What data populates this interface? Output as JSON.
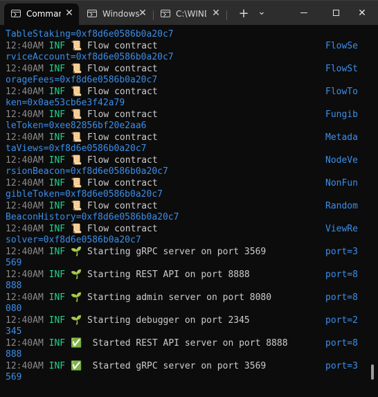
{
  "window": {
    "tabs": [
      {
        "label": "Comman",
        "active": true
      },
      {
        "label": "Windows",
        "active": false
      },
      {
        "label": "C:\\WINDO",
        "active": false
      }
    ],
    "new_tab_glyph": "+",
    "dropdown_glyph": "⌄",
    "minimize_glyph": "",
    "maximize_glyph": "",
    "close_glyph": "✕",
    "tab_close_glyph": "✕"
  },
  "colors": {
    "background": "#0c0c0c",
    "timestamp": "#8a8a8a",
    "level": "#23d18b",
    "message": "#cccccc",
    "key": "#3b8eea"
  },
  "log": {
    "top_continuation": "TableStaking=0xf8d6e0586b0a20c7",
    "entries": [
      {
        "time": "12:40AM",
        "level": "INF",
        "icon": "📜",
        "message": "Flow contract",
        "key": "FlowSe",
        "continuation": "rviceAccount=0xf8d6e0586b0a20c7"
      },
      {
        "time": "12:40AM",
        "level": "INF",
        "icon": "📜",
        "message": "Flow contract",
        "key": "FlowSt",
        "continuation": "orageFees=0xf8d6e0586b0a20c7"
      },
      {
        "time": "12:40AM",
        "level": "INF",
        "icon": "📜",
        "message": "Flow contract",
        "key": "FlowTo",
        "continuation": "ken=0x0ae53cb6e3f42a79"
      },
      {
        "time": "12:40AM",
        "level": "INF",
        "icon": "📜",
        "message": "Flow contract",
        "key": "Fungib",
        "continuation": "leToken=0xee82856bf20e2aa6"
      },
      {
        "time": "12:40AM",
        "level": "INF",
        "icon": "📜",
        "message": "Flow contract",
        "key": "Metada",
        "continuation": "taViews=0xf8d6e0586b0a20c7"
      },
      {
        "time": "12:40AM",
        "level": "INF",
        "icon": "📜",
        "message": "Flow contract",
        "key": "NodeVe",
        "continuation": "rsionBeacon=0xf8d6e0586b0a20c7"
      },
      {
        "time": "12:40AM",
        "level": "INF",
        "icon": "📜",
        "message": "Flow contract",
        "key": "NonFun",
        "continuation": "gibleToken=0xf8d6e0586b0a20c7"
      },
      {
        "time": "12:40AM",
        "level": "INF",
        "icon": "📜",
        "message": "Flow contract",
        "key": "Random",
        "continuation": "BeaconHistory=0xf8d6e0586b0a20c7"
      },
      {
        "time": "12:40AM",
        "level": "INF",
        "icon": "📜",
        "message": "Flow contract",
        "key": "ViewRe",
        "continuation": "solver=0xf8d6e0586b0a20c7"
      },
      {
        "time": "12:40AM",
        "level": "INF",
        "icon": "🌱",
        "message": "Starting gRPC server on port 3569",
        "key": "port=3",
        "continuation": "569"
      },
      {
        "time": "12:40AM",
        "level": "INF",
        "icon": "🌱",
        "message": "Starting REST API on port 8888",
        "key": "port=8",
        "continuation": "888"
      },
      {
        "time": "12:40AM",
        "level": "INF",
        "icon": "🌱",
        "message": "Starting admin server on port 8080",
        "key": "port=8",
        "continuation": "080"
      },
      {
        "time": "12:40AM",
        "level": "INF",
        "icon": "🌱",
        "message": "Starting debugger on port 2345",
        "key": "port=2",
        "continuation": "345"
      },
      {
        "time": "12:40AM",
        "level": "INF",
        "icon": "✅",
        "message": " Started REST API server on port 8888",
        "key": "port=8",
        "continuation": "888"
      },
      {
        "time": "12:40AM",
        "level": "INF",
        "icon": "✅",
        "message": " Started gRPC server on port 3569",
        "key": "port=3",
        "continuation": "569"
      }
    ]
  }
}
